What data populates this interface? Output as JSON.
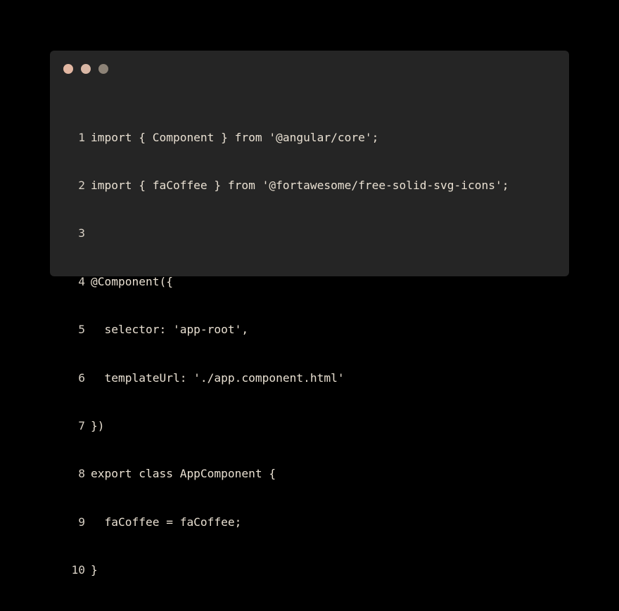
{
  "window": {
    "dots": [
      {
        "name": "close-dot",
        "color": "#e2b7a2"
      },
      {
        "name": "minimize-dot",
        "color": "#d9b7a5"
      },
      {
        "name": "maximize-dot",
        "color": "#8d8377"
      }
    ]
  },
  "code": {
    "lines": [
      {
        "number": "1",
        "text": "import { Component } from '@angular/core';"
      },
      {
        "number": "2",
        "text": "import { faCoffee } from '@fortawesome/free-solid-svg-icons';"
      },
      {
        "number": "3",
        "text": ""
      },
      {
        "number": "4",
        "text": "@Component({"
      },
      {
        "number": "5",
        "text": "  selector: 'app-root',"
      },
      {
        "number": "6",
        "text": "  templateUrl: './app.component.html'"
      },
      {
        "number": "7",
        "text": "})"
      },
      {
        "number": "8",
        "text": "export class AppComponent {"
      },
      {
        "number": "9",
        "text": "  faCoffee = faCoffee;"
      },
      {
        "number": "10",
        "text": "}"
      }
    ]
  }
}
